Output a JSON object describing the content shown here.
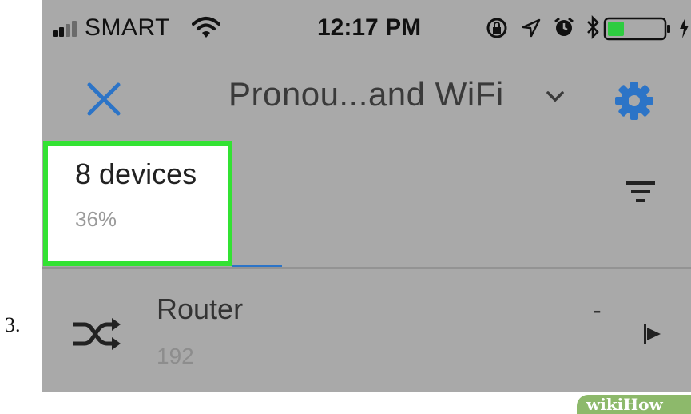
{
  "step": {
    "number": "3."
  },
  "status_bar": {
    "carrier": "SMART",
    "time": "12:17 PM",
    "battery_level": 0.3,
    "icons": [
      "signal-icon",
      "wifi-icon",
      "lock-rotation-icon",
      "location-icon",
      "alarm-icon",
      "bluetooth-icon",
      "battery-icon",
      "charging-icon"
    ]
  },
  "nav": {
    "close_icon": "close-icon",
    "title": "Pronou...and WiFi",
    "dropdown_icon": "chevron-down-icon",
    "settings_icon": "gear-icon"
  },
  "stats": {
    "device_count": "8 devices",
    "usage_percent": "36%"
  },
  "filter_icon": "filter-icon",
  "devices": [
    {
      "icon": "shuffle-icon",
      "name": "Router",
      "ip": "192",
      "value": "-",
      "action_icon": "play-icon"
    }
  ],
  "watermark": {
    "text": "wikiHow"
  },
  "colors": {
    "screen_bg": "#a9a9a9",
    "highlight_border": "#33e233",
    "accent_blue": "#2c74c7",
    "battery_fill": "#2ecc40"
  }
}
